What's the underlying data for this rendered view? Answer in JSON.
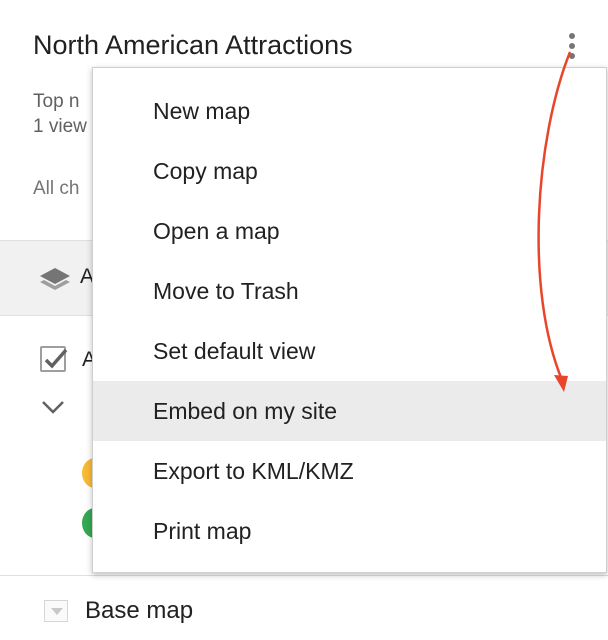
{
  "panel": {
    "title": "North American Attractions",
    "description_visible": "Top n",
    "views_visible": "1 view",
    "saved_status_visible": "All ch",
    "layer1_name_visible": "A",
    "layer2_name_visible": "A",
    "base_map_label": "Base map"
  },
  "menu": {
    "items": [
      {
        "label": "New map"
      },
      {
        "label": "Copy map"
      },
      {
        "label": "Open a map"
      },
      {
        "label": "Move to Trash"
      },
      {
        "label": "Set default view"
      },
      {
        "label": "Embed on my site"
      },
      {
        "label": "Export to KML/KMZ"
      },
      {
        "label": "Print map"
      }
    ],
    "highlighted_index": 5
  },
  "colors": {
    "annotation_arrow": "#e8452b",
    "marker_yellow": "#f9b934",
    "marker_green": "#34a853",
    "highlight": "#ebebeb"
  },
  "icons": {
    "more": "more-vert-icon",
    "layers": "layers-icon",
    "checkbox": "checkbox-checked-icon",
    "chevron": "chevron-down-icon",
    "basemap_toggle": "triangle-down-icon"
  }
}
